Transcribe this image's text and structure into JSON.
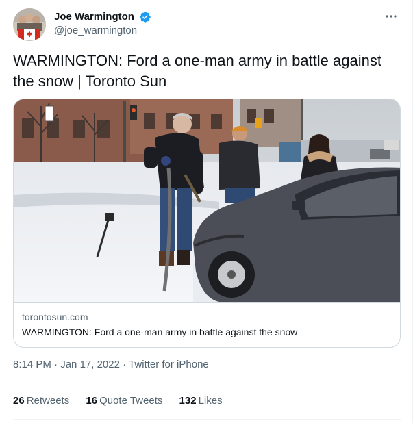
{
  "author": {
    "display_name": "Joe Warmington",
    "handle": "@joe_warmington",
    "verified": true
  },
  "tweet": {
    "text": "WARMINGTON: Ford a one-man army in battle against the snow | Toronto Sun"
  },
  "card": {
    "domain": "torontosun.com",
    "title": "WARMINGTON: Ford a one-man army in battle against the snow"
  },
  "meta": {
    "time": "8:14 PM",
    "dot1": " · ",
    "date": "Jan 17, 2022",
    "dot2": " · ",
    "source": "Twitter for iPhone"
  },
  "stats": {
    "retweets_count": "26",
    "retweets_label": "Retweets",
    "quotes_count": "16",
    "quotes_label": "Quote Tweets",
    "likes_count": "132",
    "likes_label": "Likes"
  },
  "icons": {
    "verified": "verified-badge-icon",
    "more": "more-options-icon"
  },
  "colors": {
    "verified_blue": "#1d9bf0",
    "secondary_text": "#536471",
    "border": "#cfd9de"
  }
}
